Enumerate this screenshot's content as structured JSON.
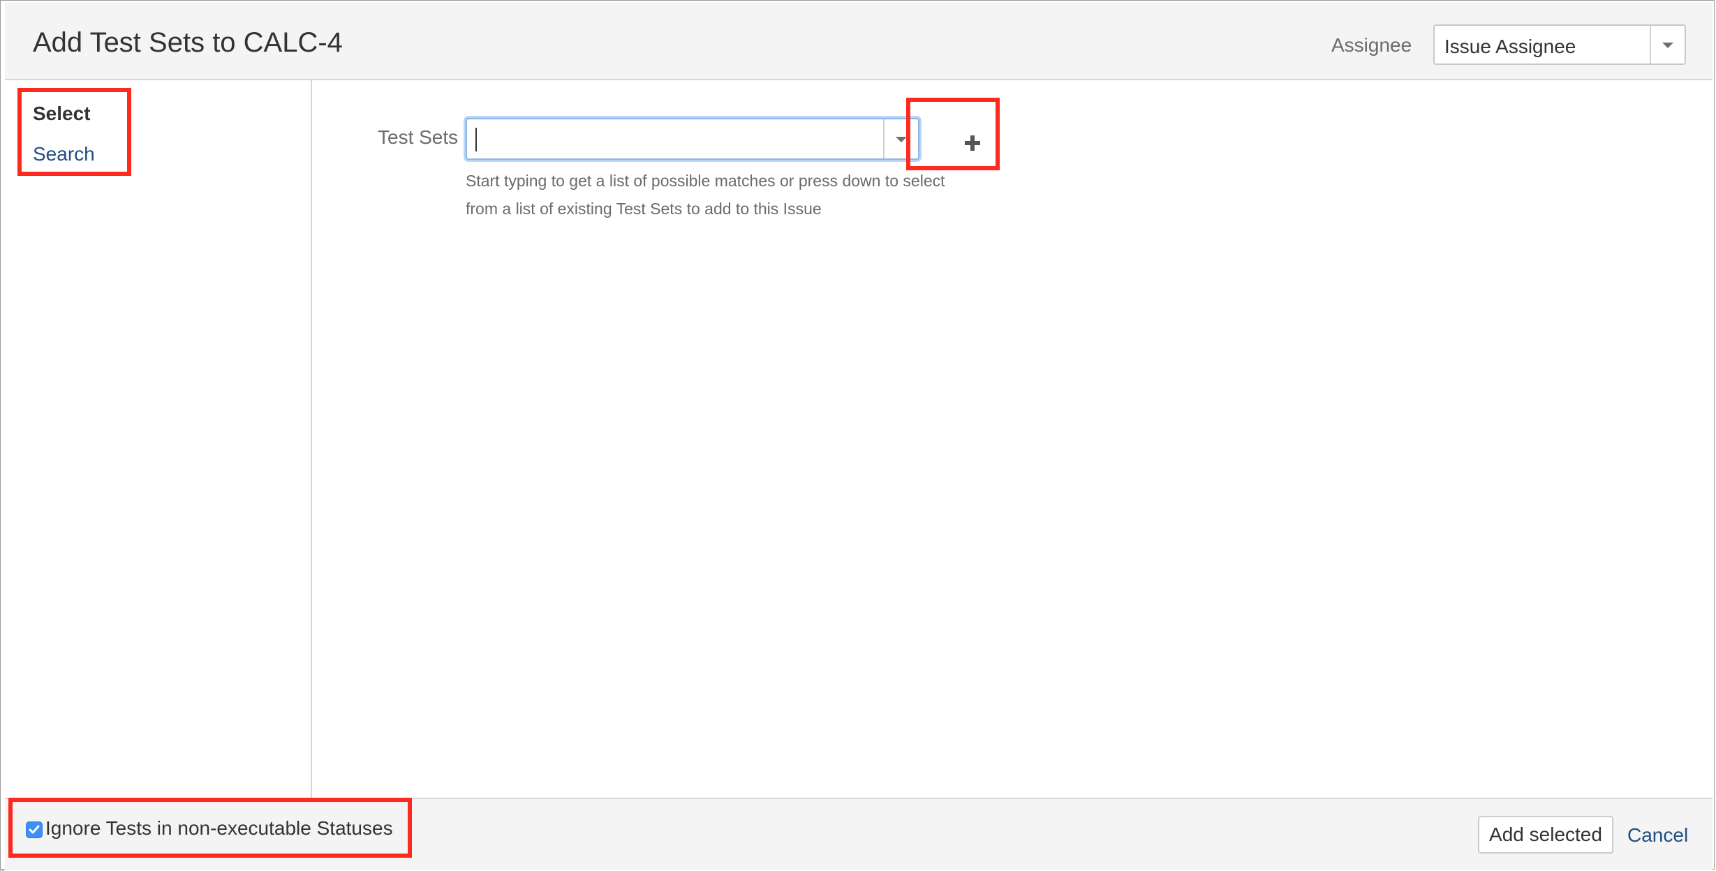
{
  "dialog": {
    "title": "Add Test Sets to CALC-4"
  },
  "header": {
    "assignee_label": "Assignee",
    "assignee_value": "Issue Assignee"
  },
  "sidebar": {
    "items": [
      {
        "label": "Select",
        "active": true
      },
      {
        "label": "Search",
        "active": false
      }
    ]
  },
  "form": {
    "test_sets_label": "Test Sets",
    "test_sets_value": "",
    "help_text": "Start typing to get a list of possible matches or press down to select from a list of existing Test Sets to add to this Issue"
  },
  "footer": {
    "checkbox_label": "Ignore Tests in non-executable Statuses",
    "checkbox_checked": true,
    "add_selected_label": "Add selected",
    "cancel_label": "Cancel"
  },
  "colors": {
    "link": "#205081",
    "highlight": "#ff2a1f",
    "checkbox": "#3d8ff5",
    "input_focus": "#8db6e6"
  },
  "icons": [
    "chevron-down-icon",
    "plus-icon",
    "checkmark-icon"
  ]
}
